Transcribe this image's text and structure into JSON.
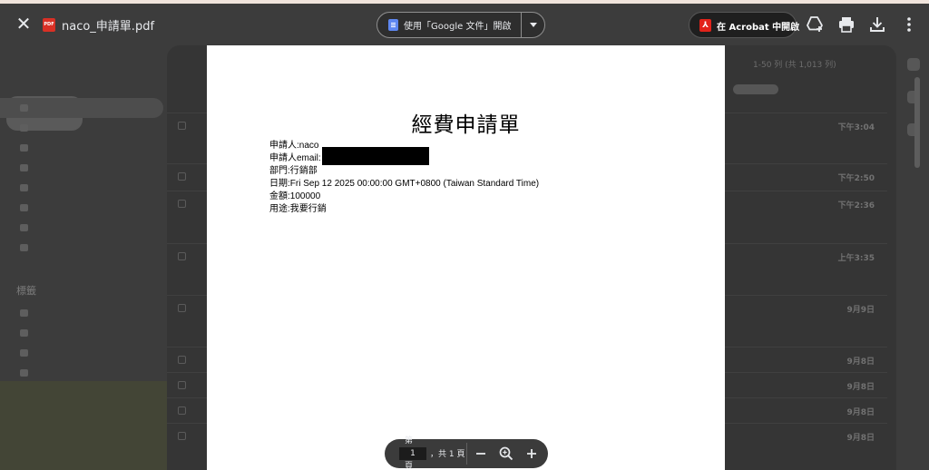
{
  "toolbar": {
    "file_name": "naco_申請單.pdf",
    "file_type_badge": "PDF",
    "open_with_google_docs": "使用「Google 文件」開啟",
    "open_in_acrobat": "在 Acrobat 中開啟",
    "icons": [
      "close-icon",
      "add-to-drive-icon",
      "print-icon",
      "download-icon",
      "more-vert-icon"
    ]
  },
  "document": {
    "title": "經費申請單",
    "fields": [
      {
        "label": "申請人",
        "value": "naco"
      },
      {
        "label": "申請人email",
        "value": ""
      },
      {
        "label": "部門",
        "value": "行銷部"
      },
      {
        "label": "日期",
        "value": "Fri Sep 12 2025 00:00:00 GMT+0800 (Taiwan Standard Time)"
      },
      {
        "label": "金額",
        "value": "100000"
      },
      {
        "label": "用途",
        "value": "我要行銷"
      }
    ],
    "separator": ":"
  },
  "page_controls": {
    "prefix_top": "第",
    "prefix_bottom": "頁",
    "current_page": "1",
    "total": "，共 1 頁"
  },
  "background": {
    "compose": "撰寫",
    "labels_heading": "標籤",
    "pager": "1-50 列 (共 1,013 列)",
    "times": [
      "下午3:04",
      "下午2:50",
      "下午2:36",
      "上午3:35",
      "9月9日",
      "9月8日",
      "9月8日",
      "9月8日",
      "9月8日"
    ]
  },
  "colors": {
    "toolbar_bg": "#3c3c3c",
    "acrobat_red": "#e2231a",
    "pdf_badge_red": "#d93025",
    "docs_blue": "#5e87f0"
  }
}
